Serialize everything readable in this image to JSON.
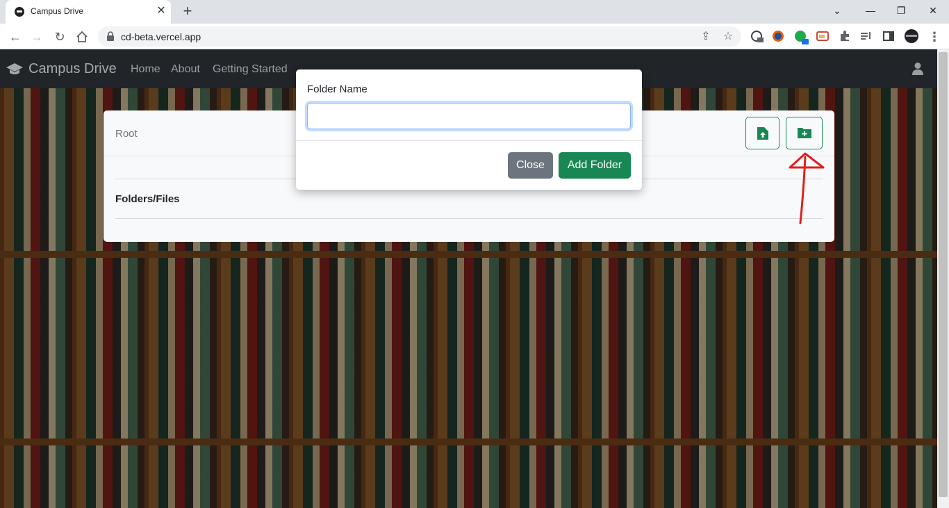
{
  "browser": {
    "tab_title": "Campus Drive",
    "tab_close": "✕",
    "new_tab": "+",
    "url": "cd-beta.vercel.app",
    "window_controls": [
      "⌄",
      "—",
      "❐",
      "✕"
    ]
  },
  "navbar": {
    "brand": "Campus Drive",
    "links": [
      "Home",
      "About",
      "Getting Started"
    ]
  },
  "drive": {
    "breadcrumb": "Root",
    "section_title": "Folders/Files"
  },
  "modal": {
    "label": "Folder Name",
    "input_value": "",
    "close_label": "Close",
    "add_label": "Add Folder"
  },
  "icons": {
    "upload": "file-upload-icon",
    "add_folder": "folder-plus-icon",
    "user": "user-icon",
    "brand": "graduation-cap-icon"
  },
  "colors": {
    "success": "#198754",
    "secondary": "#6c757d",
    "navbar": "#212529",
    "annotation": "#e0201b"
  }
}
